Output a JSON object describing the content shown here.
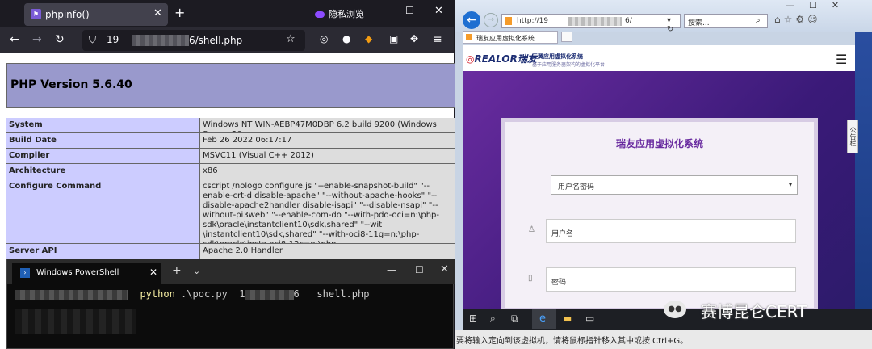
{
  "firefox": {
    "tab_title": "phpinfo()",
    "new_tab": "+",
    "private_label": "隐私浏览",
    "min": "—",
    "max": "☐",
    "close": "✕",
    "nav": {
      "back": "←",
      "forward": "→",
      "reload": "↻"
    },
    "url_prefix": "19",
    "url_suffix": "6/shell.php",
    "php_title": "PHP Version 5.6.40",
    "rows": [
      {
        "k": "System",
        "v": "Windows NT WIN-AEBP47M0DBP 6.2 build 9200 (Windows Server 20"
      },
      {
        "k": "Build Date",
        "v": "Feb 26 2022 06:17:17"
      },
      {
        "k": "Compiler",
        "v": "MSVC11 (Visual C++ 2012)"
      },
      {
        "k": "Architecture",
        "v": "x86"
      },
      {
        "k": "Configure Command",
        "v": "cscript /nologo configure.js \"--enable-snapshot-build\" \"--enable-crt-d disable-apache\" \"--without-apache-hooks\" \"--disable-apache2handler disable-isapi\" \"--disable-nsapi\" \"--without-pi3web\" \"--enable-com-do \"--with-pdo-oci=n:\\php-sdk\\oracle\\instantclient10\\sdk,shared\" \"--wit \\instantclient10\\sdk,shared\" \"--with-oci8-11g=n:\\php-sdk\\oracle\\insta oci8-12c=n:\\php-sdk\\oracle\\instantclient12\\sdk,shared\" \"--without-pe"
      },
      {
        "k": "Server API",
        "v": "Apache 2.0 Handler"
      }
    ]
  },
  "powershell": {
    "tab_title": "Windows PowerShell",
    "close": "✕",
    "plus": "+",
    "dropdown": "⌄",
    "min": "—",
    "max": "☐",
    "win_close": "✕",
    "cmd": "python",
    "args1": ".\\poc.py  1",
    "args2": "6   shell.php"
  },
  "ie": {
    "url_prefix": "http://19",
    "url_suffix": "6/",
    "search_placeholder": "搜索...",
    "tab_title": "瑞友应用虚拟化系统",
    "logo_realor": "REALOR",
    "logo_cn": "瑞友",
    "logo_t1": "天翼应用虚拟化系统",
    "logo_t2": "基于应用服务器架构的虚拟化平台",
    "panel_title": "瑞友应用虚拟化系统",
    "select_value": "用户名密码",
    "username_placeholder": "用户名",
    "password_placeholder": "密码",
    "side_tab": "公告栏",
    "status": "要将输入定向到该虚拟机，请将鼠标指针移入其中或按 Ctrl+G。"
  },
  "watermark": "赛博昆仑CERT",
  "colors": {
    "php_header": "#9999cc",
    "php_key": "#ccccff",
    "php_val": "#dddddd",
    "brand_purple": "#6a2ca0"
  }
}
